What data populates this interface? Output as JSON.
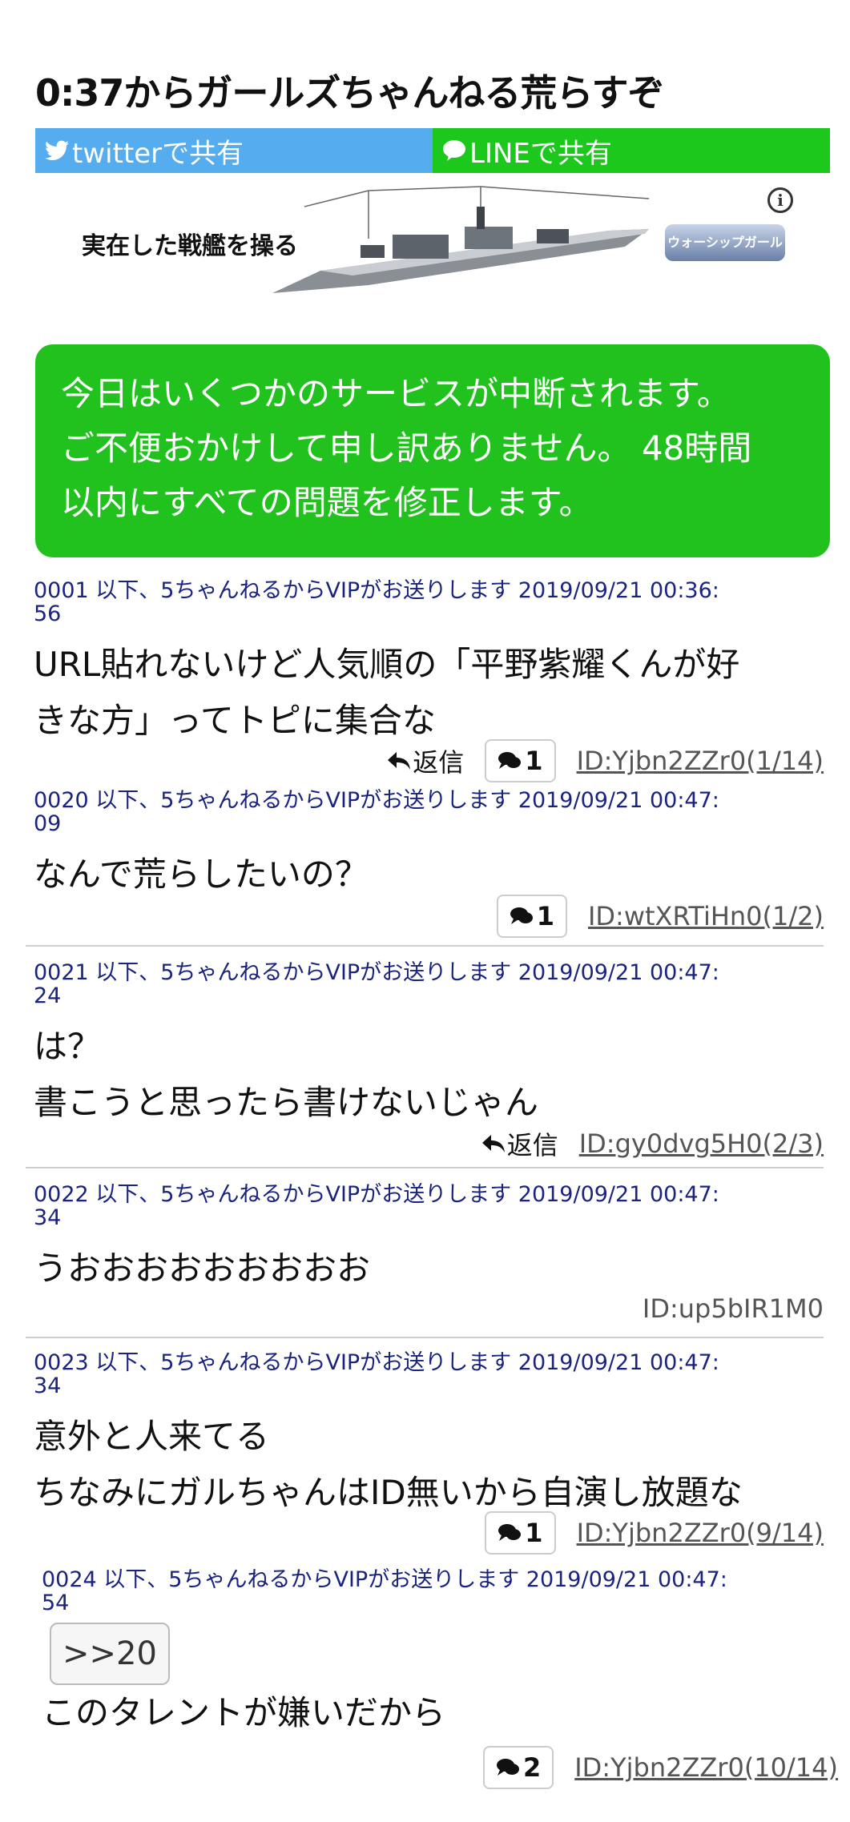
{
  "thread": {
    "title": "0:37からガールズちゃんねる荒らすぞ"
  },
  "share": {
    "twitter": "twitterで共有",
    "line": "LINEで共有"
  },
  "ad": {
    "text": "実在した戦艦を操る",
    "logo": "ウォーシップガール",
    "info": "i"
  },
  "notice": {
    "line1": "今日はいくつかのサービスが中断されます。",
    "line2": "ご不便おかけして申し訳ありません。 48時間",
    "line3": "以内にすべての問題を修正します。"
  },
  "posts": [
    {
      "meta1": "0001 以下、5ちゃんねるからVIPがお送りします 2019/09/21 00:36:",
      "meta2": "56",
      "line1": "URL貼れないけど人気順の「平野紫耀くんが好",
      "line2": "きな方」ってトピに集合な",
      "reply": "返信",
      "count": "1",
      "id": "ID:Yjbn2ZZr0(1/14)"
    },
    {
      "meta1": "0020 以下、5ちゃんねるからVIPがお送りします 2019/09/21 00:47:",
      "meta2": "09",
      "line1": "なんで荒らしたいの？",
      "count": "1",
      "id": "ID:wtXRTiHn0(1/2)"
    },
    {
      "meta1": "0021 以下、5ちゃんねるからVIPがお送りします 2019/09/21 00:47:",
      "meta2": "24",
      "line1": "は？",
      "line2": "書こうと思ったら書けないじゃん",
      "reply": "返信",
      "id": "ID:gy0dvg5H0(2/3)"
    },
    {
      "meta1": "0022 以下、5ちゃんねるからVIPがお送りします 2019/09/21 00:47:",
      "meta2": "34",
      "line1": "うおおおおおおおおお",
      "id": "ID:up5bIR1M0"
    },
    {
      "meta1": "0023 以下、5ちゃんねるからVIPがお送りします 2019/09/21 00:47:",
      "meta2": "34",
      "line1": "意外と人来てる",
      "line2": "ちなみにガルちゃんはID無いから自演し放題な",
      "count": "1",
      "id": "ID:Yjbn2ZZr0(9/14)"
    },
    {
      "meta1": "0024 以下、5ちゃんねるからVIPがお送りします 2019/09/21 00:47:",
      "meta2": "54",
      "anchor": ">>20",
      "line1": "このタレントが嫌いだから",
      "count": "2",
      "id": "ID:Yjbn2ZZr0(10/14)"
    }
  ],
  "colors": {
    "twitter": "#55acee",
    "line": "#1dc81d",
    "notice": "#21c21d",
    "meta": "#1a237e"
  }
}
